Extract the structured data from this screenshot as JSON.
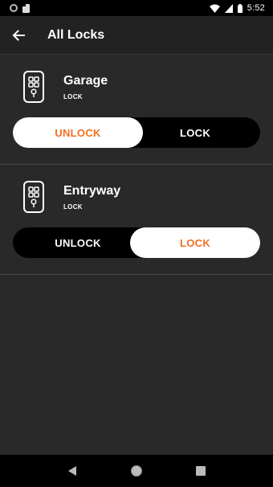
{
  "status_bar": {
    "time": "5:52"
  },
  "app_bar": {
    "title": "All Locks"
  },
  "locks": [
    {
      "name": "Garage",
      "state": "LOCK",
      "unlock_label": "UNLOCK",
      "lock_label": "LOCK",
      "selected": "unlock"
    },
    {
      "name": "Entryway",
      "state": "LOCK",
      "unlock_label": "UNLOCK",
      "lock_label": "LOCK",
      "selected": "lock"
    }
  ],
  "colors": {
    "accent": "#f36f21",
    "background": "#292929",
    "app_bar": "#222222",
    "toggle_track": "#000000"
  },
  "icons": [
    "back-arrow-icon",
    "lock-device-icon",
    "nav-back-icon",
    "nav-home-icon",
    "nav-recents-icon"
  ]
}
